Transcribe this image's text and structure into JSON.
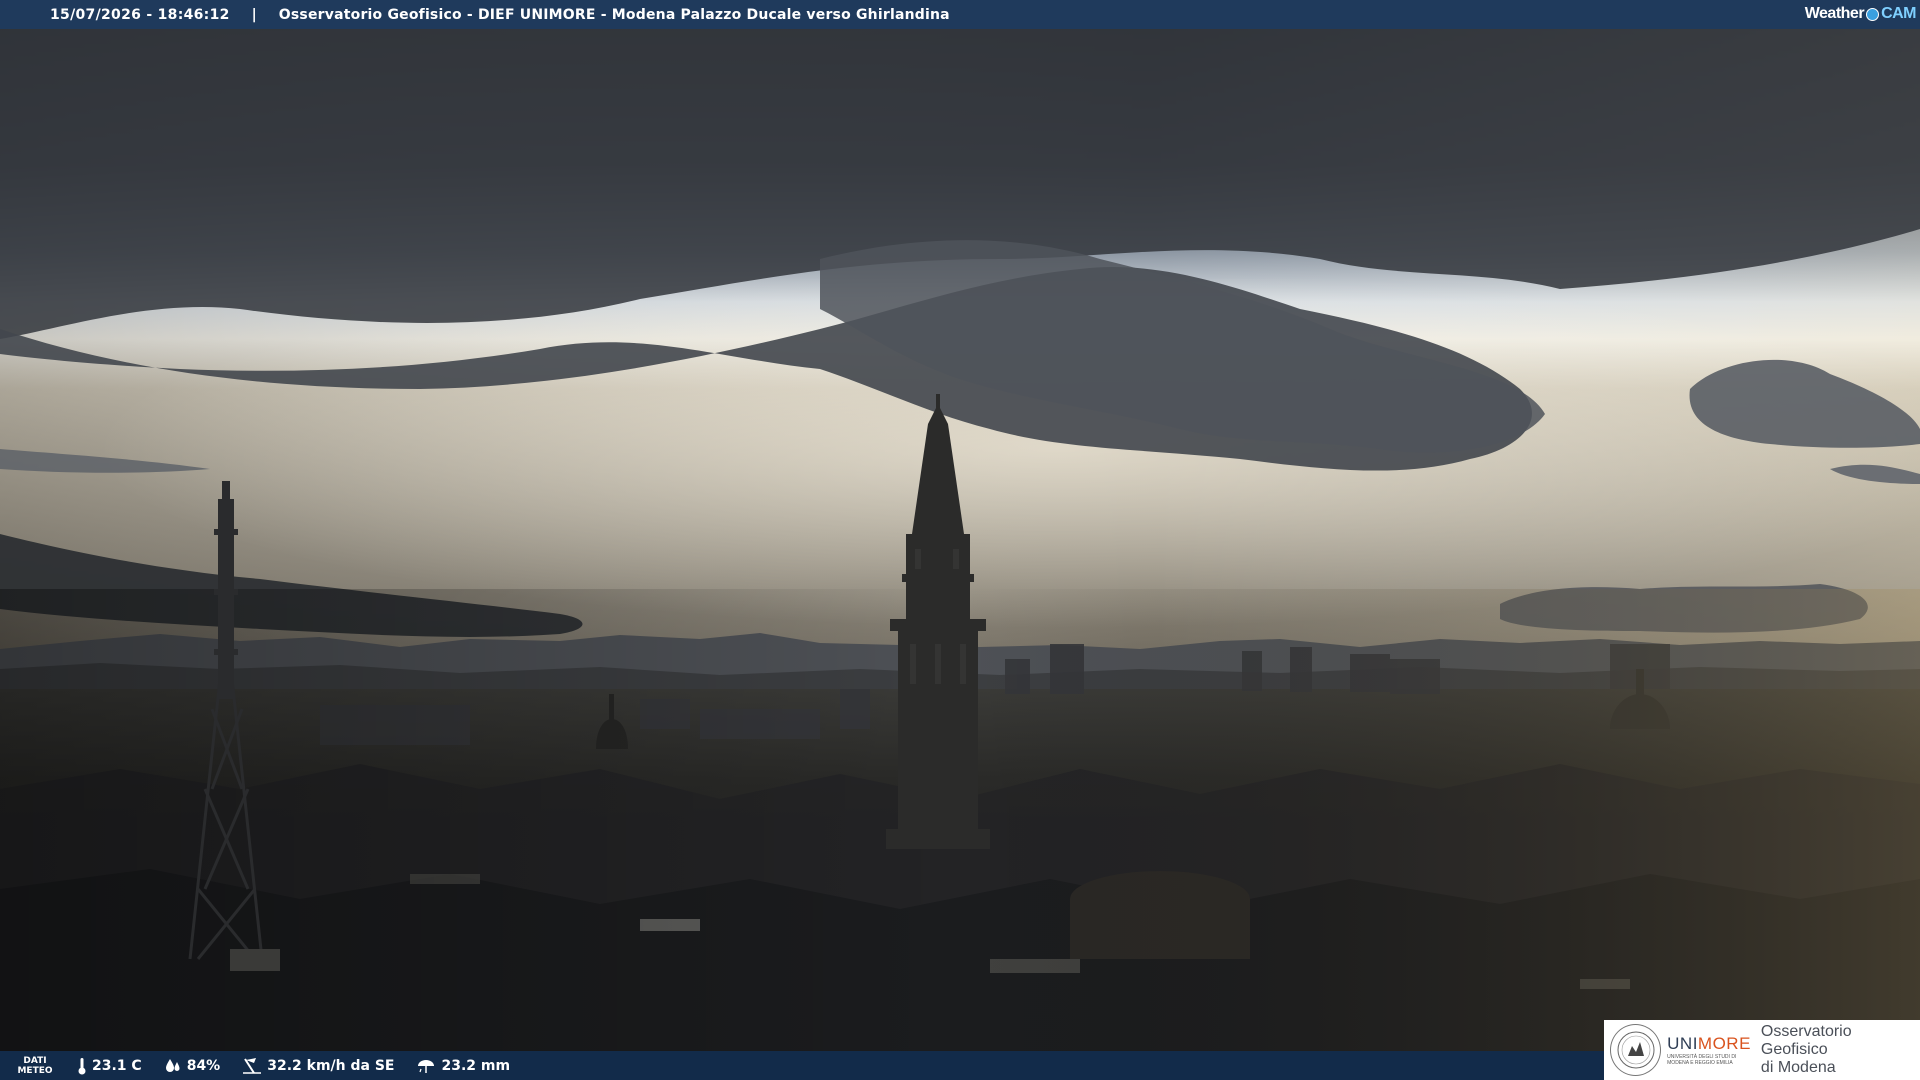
{
  "header": {
    "timestamp": "15/07/2026 - 18:46:12",
    "separator": "|",
    "location": "Osservatorio Geofisico - DIEF UNIMORE - Modena Palazzo Ducale verso Ghirlandina",
    "logo_weather": "Weather",
    "logo_cam": "CAM"
  },
  "weather_bar": {
    "label_line1": "DATI",
    "label_line2": "METEO",
    "items": [
      {
        "icon": "thermometer-icon",
        "value": "23.1 C"
      },
      {
        "icon": "humidity-icon",
        "value": "84%"
      },
      {
        "icon": "wind-icon",
        "value": "32.2 km/h da SE"
      },
      {
        "icon": "rain-gauge-icon",
        "value": "23.2 mm"
      }
    ]
  },
  "branding": {
    "uni_part1": "UNI",
    "uni_part2": "MORE",
    "uni_sub1": "UNIVERSITÀ DEGLI STUDI DI",
    "uni_sub2": "MODENA E REGGIO EMILIA",
    "observatory_line1": "Osservatorio Geofisico",
    "observatory_line2": "di Modena"
  },
  "colors": {
    "top_bar": "#1f3a5c",
    "bottom_bar": "#122b4a",
    "unimore_accent": "#d9531e",
    "unimore_dark": "#2f3e55"
  }
}
